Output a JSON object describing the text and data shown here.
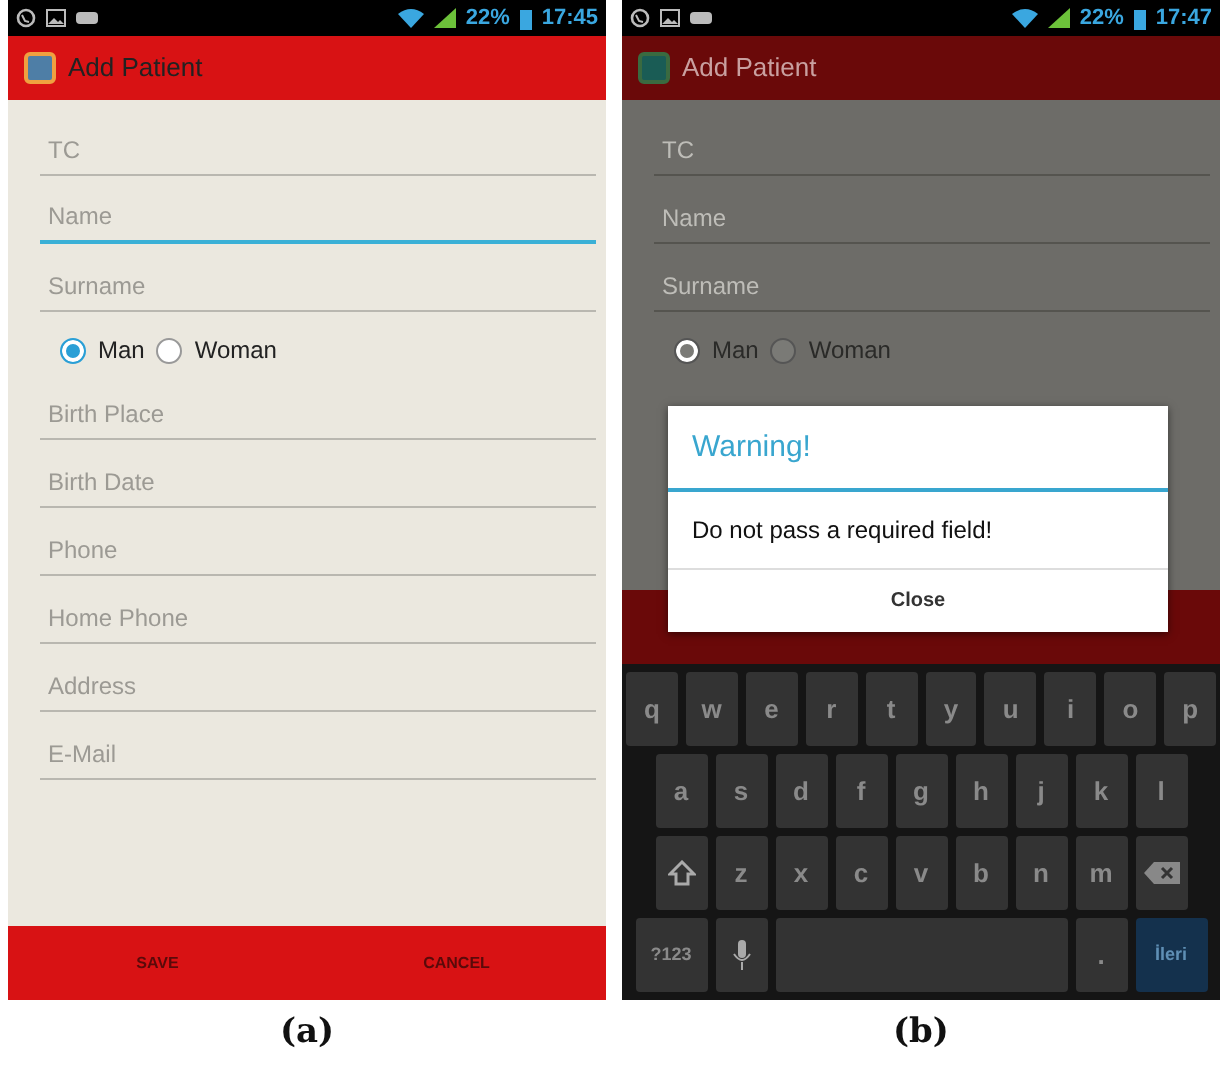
{
  "panels": [
    {
      "caption": "(a)",
      "dimmed": false,
      "status_bar": {
        "battery": "22%",
        "time": "17:45"
      },
      "app_bar": {
        "title": "Add Patient"
      },
      "fields_top": [
        {
          "placeholder": "TC",
          "focused": false
        },
        {
          "placeholder": "Name",
          "focused": true
        },
        {
          "placeholder": "Surname",
          "focused": false
        }
      ],
      "gender": [
        {
          "label": "Man",
          "selected": true
        },
        {
          "label": "Woman",
          "selected": false
        }
      ],
      "fields_bottom": [
        {
          "placeholder": "Birth Place",
          "focused": false
        },
        {
          "placeholder": "Birth Date",
          "focused": false
        },
        {
          "placeholder": "Phone",
          "focused": false
        },
        {
          "placeholder": "Home Phone",
          "focused": false
        },
        {
          "placeholder": "Address",
          "focused": false
        },
        {
          "placeholder": "E-Mail",
          "focused": false
        }
      ],
      "bottom_bar": [
        "SAVE",
        "CANCEL"
      ]
    },
    {
      "caption": "(b)",
      "dimmed": true,
      "status_bar": {
        "battery": "22%",
        "time": "17:47"
      },
      "app_bar": {
        "title": "Add Patient"
      },
      "fields_top": [
        {
          "placeholder": "TC",
          "focused": false
        },
        {
          "placeholder": "Name",
          "focused": false
        },
        {
          "placeholder": "Surname",
          "focused": false
        }
      ],
      "gender": [
        {
          "label": "Man",
          "selected": true
        },
        {
          "label": "Woman",
          "selected": false
        }
      ],
      "dialog": {
        "title": "Warning!",
        "message": "Do not pass a required field!",
        "button": "Close"
      },
      "keyboard": [
        [
          {
            "kind": "char",
            "label": "q"
          },
          {
            "kind": "char",
            "label": "w"
          },
          {
            "kind": "char",
            "label": "e"
          },
          {
            "kind": "char",
            "label": "r"
          },
          {
            "kind": "char",
            "label": "t"
          },
          {
            "kind": "char",
            "label": "y"
          },
          {
            "kind": "char",
            "label": "u"
          },
          {
            "kind": "char",
            "label": "i"
          },
          {
            "kind": "char",
            "label": "o"
          },
          {
            "kind": "char",
            "label": "p"
          }
        ],
        [
          {
            "kind": "char",
            "label": "a"
          },
          {
            "kind": "char",
            "label": "s"
          },
          {
            "kind": "char",
            "label": "d"
          },
          {
            "kind": "char",
            "label": "f"
          },
          {
            "kind": "char",
            "label": "g"
          },
          {
            "kind": "char",
            "label": "h"
          },
          {
            "kind": "char",
            "label": "j"
          },
          {
            "kind": "char",
            "label": "k"
          },
          {
            "kind": "char",
            "label": "l"
          }
        ],
        [
          {
            "kind": "shift"
          },
          {
            "kind": "char",
            "label": "z"
          },
          {
            "kind": "char",
            "label": "x"
          },
          {
            "kind": "char",
            "label": "c"
          },
          {
            "kind": "char",
            "label": "v"
          },
          {
            "kind": "char",
            "label": "b"
          },
          {
            "kind": "char",
            "label": "n"
          },
          {
            "kind": "char",
            "label": "m"
          },
          {
            "kind": "backspace"
          }
        ],
        [
          {
            "kind": "symbols",
            "label": "?123"
          },
          {
            "kind": "mic"
          },
          {
            "kind": "space"
          },
          {
            "kind": "char",
            "label": "."
          },
          {
            "kind": "action",
            "label": "İleri"
          }
        ]
      ]
    }
  ]
}
